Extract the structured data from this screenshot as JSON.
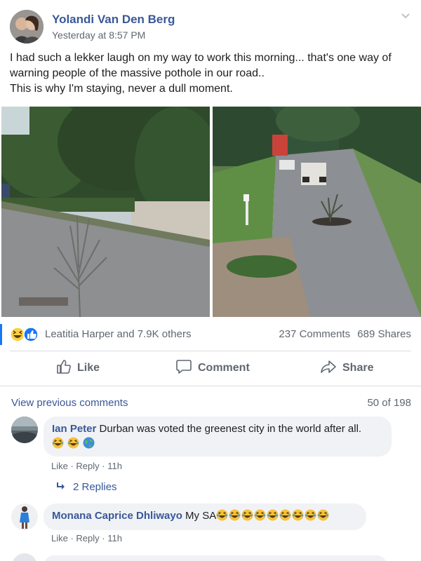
{
  "post": {
    "author": "Yolandi Van Den Berg",
    "timestamp": "Yesterday at 8:57 PM",
    "text_line1": "I had such a lekker laugh on my way to work this morning... that's one way of",
    "text_line2": "warning people of the massive pothole in our road..",
    "text_line3": "This is why I'm staying, never a dull moment."
  },
  "reactions": {
    "icons": [
      "haha-reaction-icon",
      "like-reaction-icon"
    ],
    "label": "Leatitia Harper and 7.9K others",
    "comments": "237 Comments",
    "shares": "689 Shares"
  },
  "actions": {
    "like": "Like",
    "comment": "Comment",
    "share": "Share"
  },
  "comments_header": {
    "view_previous": "View previous comments",
    "count": "50 of 198"
  },
  "comments": [
    {
      "name": "Ian Peter",
      "text": "Durban was voted the greenest city in the world after all.",
      "emojis": [
        "laughing-emoji",
        "laughing-emoji",
        "globe-emoji"
      ],
      "like": "Like",
      "reply": "Reply",
      "time": "11h",
      "replies_label": "2 Replies"
    },
    {
      "name": "Monana Caprice Dhliwayo",
      "text": "My SA",
      "emojis": [
        "laughing-emoji",
        "laughing-emoji",
        "laughing-emoji",
        "laughing-emoji",
        "laughing-emoji",
        "laughing-emoji",
        "laughing-emoji",
        "laughing-emoji",
        "laughing-emoji"
      ],
      "like": "Like",
      "reply": "Reply",
      "time": "11h"
    }
  ],
  "colors": {
    "link": "#385898",
    "meta": "#606770",
    "bubble": "#f0f2f5",
    "like_blue": "#1877f2"
  }
}
